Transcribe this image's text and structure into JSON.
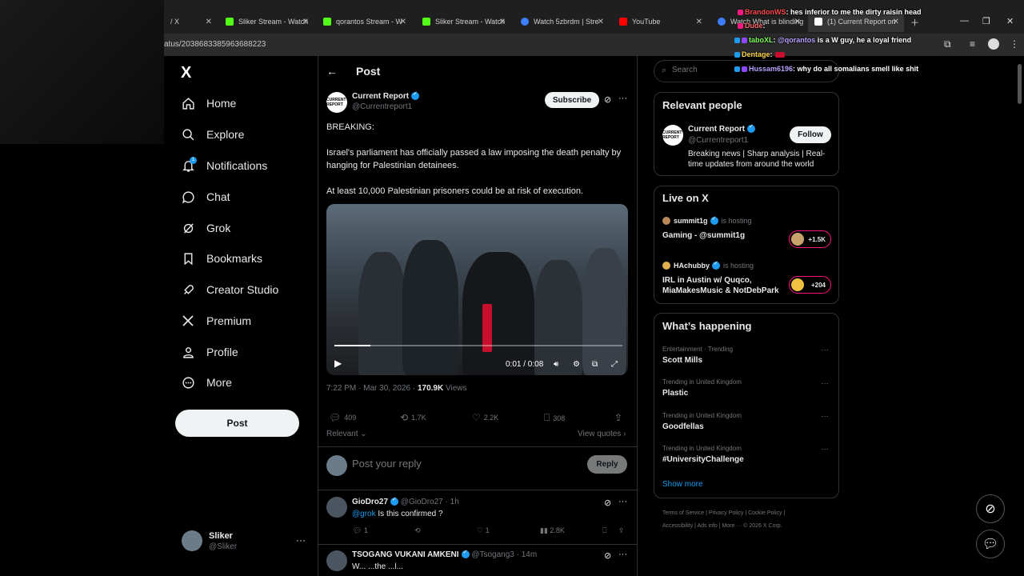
{
  "browser": {
    "tabs": [
      {
        "title": "/ X",
        "icon_color": "#000000"
      },
      {
        "title": "Sliker Stream - Watch",
        "icon_color": "#53fc18"
      },
      {
        "title": "qorantos Stream - W",
        "icon_color": "#53fc18"
      },
      {
        "title": "Sliker Stream - Watch",
        "icon_color": "#53fc18"
      },
      {
        "title": "Watch 5zbrdm | Stre",
        "icon_color": "#3d7eff"
      },
      {
        "title": "YouTube",
        "icon_color": "#ff0000"
      },
      {
        "title": "Watch What is blinding",
        "icon_color": "#3d7eff"
      },
      {
        "title": "(1) Current Report on",
        "icon_color": "#000000"
      }
    ],
    "url": "atus/2038683385963688223"
  },
  "nav": {
    "logo": "X",
    "items": [
      {
        "label": "Home",
        "icon": "home-icon"
      },
      {
        "label": "Explore",
        "icon": "search-icon"
      },
      {
        "label": "Notifications",
        "icon": "bell-icon"
      },
      {
        "label": "Chat",
        "icon": "chat-icon"
      },
      {
        "label": "Grok",
        "icon": "grok-icon"
      },
      {
        "label": "Bookmarks",
        "icon": "bookmark-icon"
      },
      {
        "label": "Creator Studio",
        "icon": "rocket-icon"
      },
      {
        "label": "Premium",
        "icon": "x-icon"
      },
      {
        "label": "Profile",
        "icon": "person-icon"
      },
      {
        "label": "More",
        "icon": "more-circle-icon"
      }
    ],
    "notification_count": "1",
    "post_button": "Post",
    "account": {
      "name": "Sliker",
      "handle": "@Sliker"
    }
  },
  "post": {
    "header": "Post",
    "author_name": "Current Report",
    "author_handle": "@Currentreport1",
    "avatar_text": "CURRENT REPORT",
    "subscribe": "Subscribe",
    "text_lines": [
      "BREAKING:",
      "Israel's parliament has officially passed a law imposing the death penalty by hanging for Palestinian detainees.",
      "At least 10,000 Palestinian prisoners could be at risk of execution."
    ],
    "video": {
      "time": "0:01 / 0:08",
      "progress": 0.125
    },
    "timestamp": "7:22 PM · Mar 30, 2026 ·",
    "views_count": "170.9K",
    "views_label": "Views",
    "stats": {
      "replies": "409",
      "reposts": "1.7K",
      "likes": "2.2K",
      "bookmarks": "308"
    },
    "sort_label": "Relevant",
    "view_quotes": "View quotes",
    "reply_placeholder": "Post your reply",
    "reply_button": "Reply"
  },
  "comments": [
    {
      "name": "GioDro27",
      "handle": "@GioDro27",
      "time": "1h",
      "mention": "@grok",
      "text": "Is this confirmed ?",
      "replies": "1",
      "likes": "1",
      "views": "2.8K"
    },
    {
      "name": "TSOGANG VUKANI AMKENI",
      "handle": "@Tsogang3",
      "time": "14m",
      "text": "W... ...the ...l..."
    }
  ],
  "right": {
    "search_placeholder": "Search",
    "relevant_people_title": "Relevant people",
    "person": {
      "name": "Current Report",
      "handle": "@Currentreport1",
      "bio": "Breaking news | Sharp analysis | Real-time updates from around the world",
      "follow": "Follow",
      "avatar_text": "CURRENT REPORT"
    },
    "live_title": "Live on X",
    "live": [
      {
        "host": "summit1g",
        "hosting": "is hosting",
        "title": "Gaming - @summit1g",
        "count": "+1.5K"
      },
      {
        "host": "HAchubby",
        "hosting": "is hosting",
        "title": "IRL in Austin w/ Quqco, MiaMakesMusic & NotDebPark",
        "count": "+204"
      }
    ],
    "happening_title": "What’s happening",
    "trends": [
      {
        "category": "Entertainment · Trending",
        "name": "Scott Mills"
      },
      {
        "category": "Trending in United Kingdom",
        "name": "Plastic"
      },
      {
        "category": "Trending in United Kingdom",
        "name": "Goodfellas"
      },
      {
        "category": "Trending in United Kingdom",
        "name": "#UniversityChallenge"
      }
    ],
    "show_more": "Show more",
    "footer_line1": "Terms of Service  |  Privacy Policy  |  Cookie Policy  |",
    "footer_line2": "Accessibility  |  Ads info  |  More ···  © 2026 X Corp."
  },
  "chat_overlay": [
    {
      "user": "BrandonWS",
      "msg": ": hes inferior to me the dirty raisin head",
      "color": "#ff4b4b"
    },
    {
      "user": "Dude",
      "msg": ":",
      "color": "#ff6b6b"
    },
    {
      "user": "taboXL",
      "msg": ": ",
      "mention": "@qorantos",
      "msg2": " is a W guy, he a loyal friend",
      "color": "#7cff5a"
    },
    {
      "user": "Dentage",
      "msg": ":",
      "color": "#ffd34d"
    },
    {
      "user": "Hussam6196",
      "msg": ": why do all somalians smell like shit",
      "color": "#b9a2ff"
    }
  ]
}
